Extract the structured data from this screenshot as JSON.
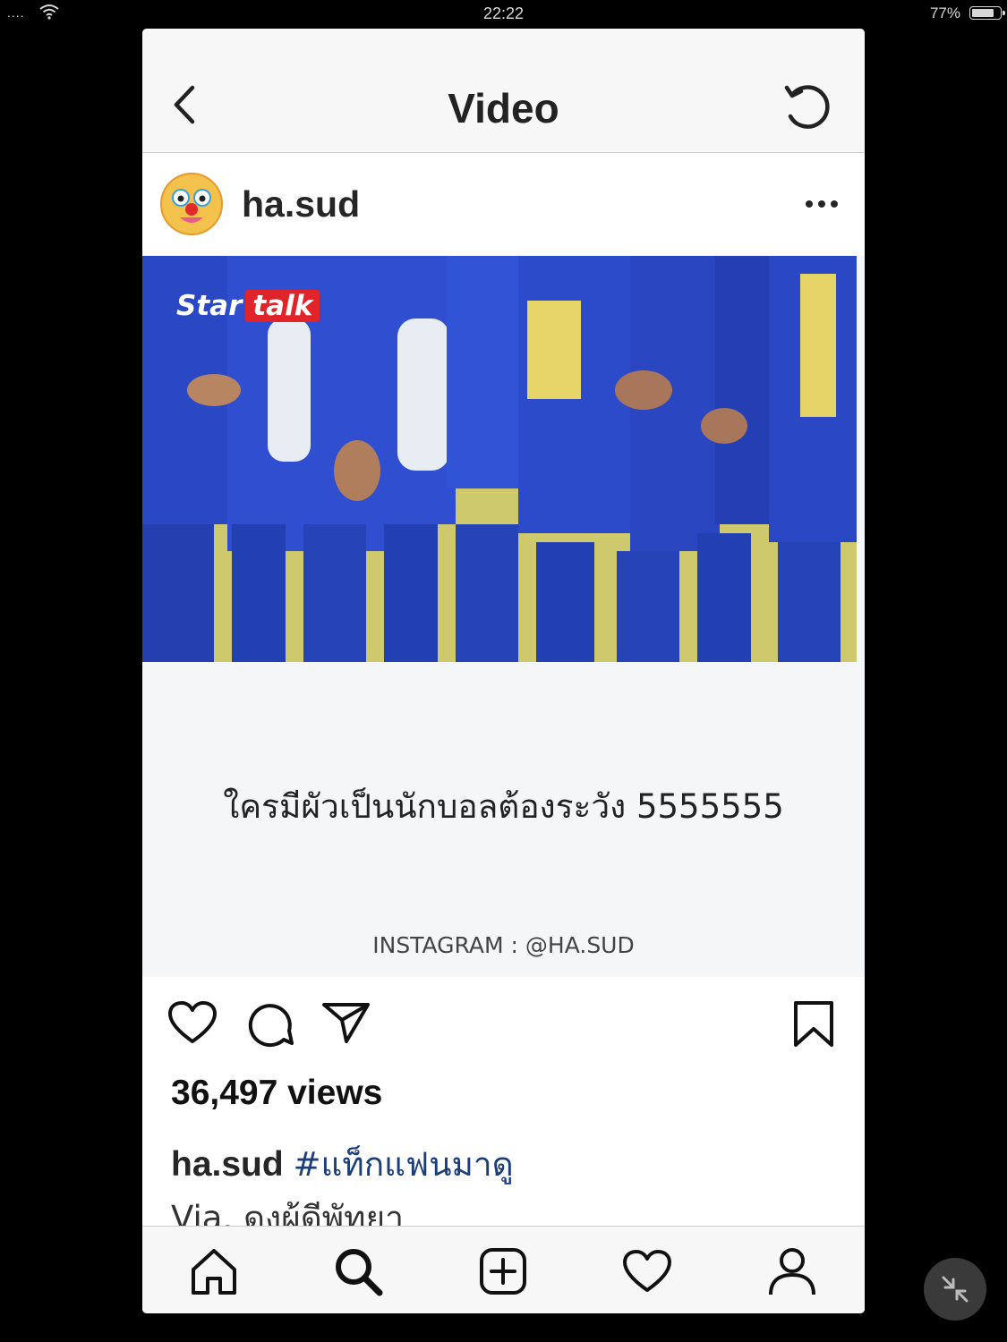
{
  "status_bar": {
    "signal": "....",
    "time": "22:22",
    "battery_pct": "77%"
  },
  "header": {
    "title": "Video",
    "back_icon": "chevron-left-icon",
    "refresh_icon": "refresh-icon"
  },
  "post": {
    "username": "ha.sud",
    "more_icon": "ellipsis-icon",
    "video": {
      "brand_part1": "Star",
      "brand_part2": "talk",
      "caption": "ใครมีผัวเป็นนักบอลต้องระวัง 5555555",
      "credit": "INSTAGRAM  :  @HA.SUD"
    },
    "views": "36,497 views",
    "caption_user": "ha.sud",
    "caption_tag": "#แท็กแฟนมาดู",
    "caption_line2": "Via. ดงผ้ดีพัทยา"
  },
  "actions": [
    "heart-icon",
    "comment-icon",
    "share-icon",
    "bookmark-icon"
  ],
  "tabbar": [
    "home-icon",
    "search-icon",
    "add-icon",
    "activity-heart-icon",
    "profile-icon"
  ],
  "colors": {
    "background": "#000000",
    "header_bg": "#f7f7f7",
    "hashtag": "#1b3d7a",
    "jersey_blue": "#2a47c8",
    "field_yellow": "#d8d27a"
  }
}
